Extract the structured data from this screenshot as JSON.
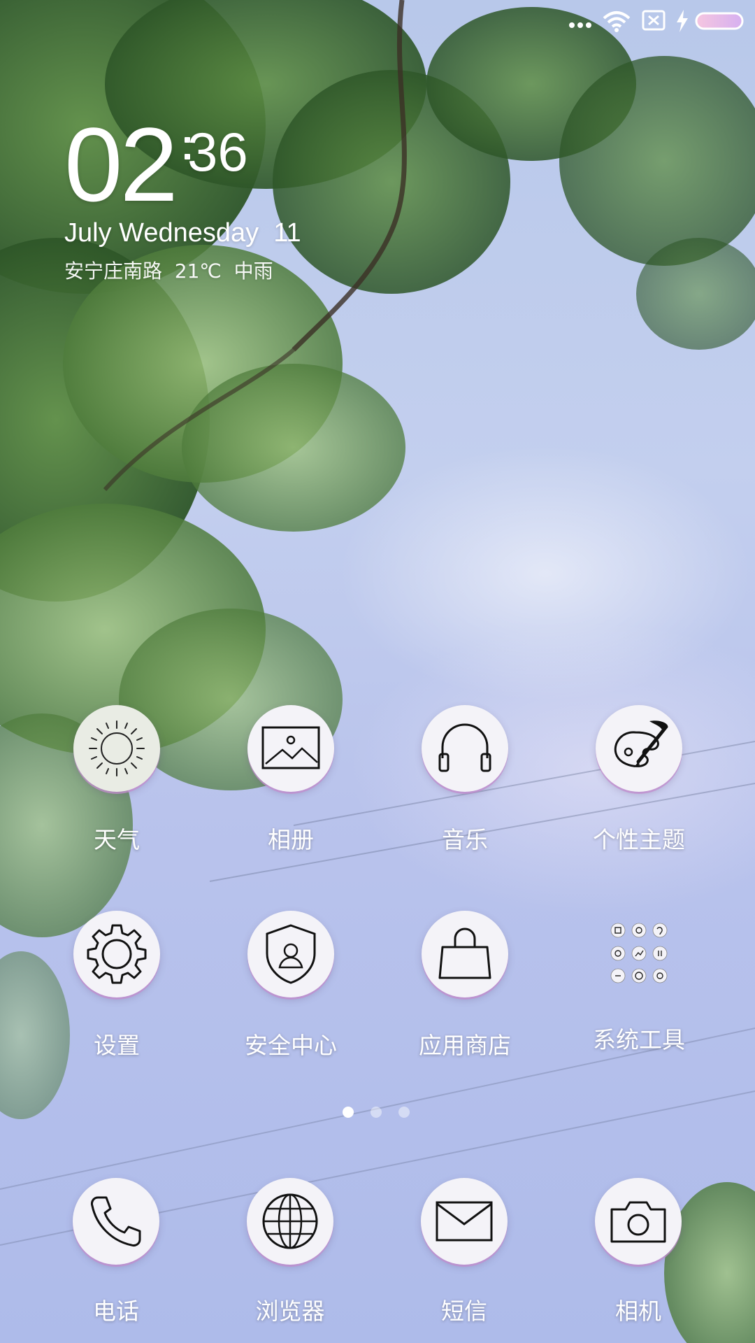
{
  "status_bar": {
    "icons": [
      "more-dots-icon",
      "wifi-icon",
      "no-sim-icon",
      "charging-icon",
      "battery-icon"
    ]
  },
  "clock": {
    "hours": "02",
    "minutes": "36",
    "date": "July Wednesday  11",
    "weather": "安宁庄南路  21℃  中雨"
  },
  "apps": {
    "row1": [
      {
        "label": "天气",
        "icon": "sun-icon"
      },
      {
        "label": "相册",
        "icon": "image-icon"
      },
      {
        "label": "音乐",
        "icon": "headphones-icon"
      },
      {
        "label": "个性主题",
        "icon": "palette-brush-icon"
      }
    ],
    "row2": [
      {
        "label": "设置",
        "icon": "gear-icon"
      },
      {
        "label": "安全中心",
        "icon": "shield-user-icon"
      },
      {
        "label": "应用商店",
        "icon": "shopping-bag-icon"
      },
      {
        "label": "系统工具",
        "icon": "folder-grid-icon"
      }
    ]
  },
  "page_indicator": {
    "total": 3,
    "active": 1
  },
  "dock": [
    {
      "label": "电话",
      "icon": "phone-icon"
    },
    {
      "label": "浏览器",
      "icon": "globe-icon"
    },
    {
      "label": "短信",
      "icon": "envelope-icon"
    },
    {
      "label": "相机",
      "icon": "camera-icon"
    }
  ],
  "colors": {
    "sky": "#b9c5ec",
    "icon_bg": "#f4f3f8",
    "icon_ring": "#c38ccd",
    "text": "#ffffff",
    "leaf_dark": "#2f5a2a",
    "leaf_light": "#7fae5a"
  }
}
